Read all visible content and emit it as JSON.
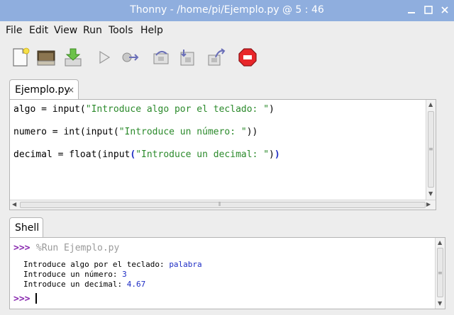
{
  "window": {
    "title": "Thonny  -  /home/pi/Ejemplo.py  @  5 : 46"
  },
  "menu": [
    "File",
    "Edit",
    "View",
    "Run",
    "Tools",
    "Help"
  ],
  "toolbar": {
    "icons": [
      "new-file-icon",
      "open-folder-icon",
      "save-icon",
      "run-icon",
      "debug-icon",
      "step-over-icon",
      "step-into-icon",
      "step-out-icon",
      "stop-icon"
    ],
    "accent": "#e8262a"
  },
  "editor": {
    "tab_label": "Ejemplo.py",
    "tab_close": "×",
    "lines": [
      {
        "pre": "algo = input(",
        "str": "\"Introduce algo por el teclado: \"",
        "post": ")"
      },
      {
        "pre": "numero = int(input(",
        "str": "\"Introduce un número: \"",
        "post": "))"
      },
      {
        "pre": "decimal = float(input",
        "paren_open": "(",
        "str": "\"Introduce un decimal: \"",
        "post": ")",
        "paren_close": ")"
      }
    ]
  },
  "shell": {
    "tab_label": "Shell",
    "prompt": ">>>",
    "run_command": "%Run Ejemplo.py",
    "outputs": [
      {
        "text": "Introduce algo por el teclado: ",
        "input": "palabra"
      },
      {
        "text": "Introduce un número: ",
        "input": "3"
      },
      {
        "text": "Introduce un decimal: ",
        "input": "4.67"
      }
    ]
  },
  "colors": {
    "titlebar": "#8faede",
    "string": "#2b8a2b",
    "prompt": "#8a2bb0",
    "user_input": "#1d2cc4"
  }
}
